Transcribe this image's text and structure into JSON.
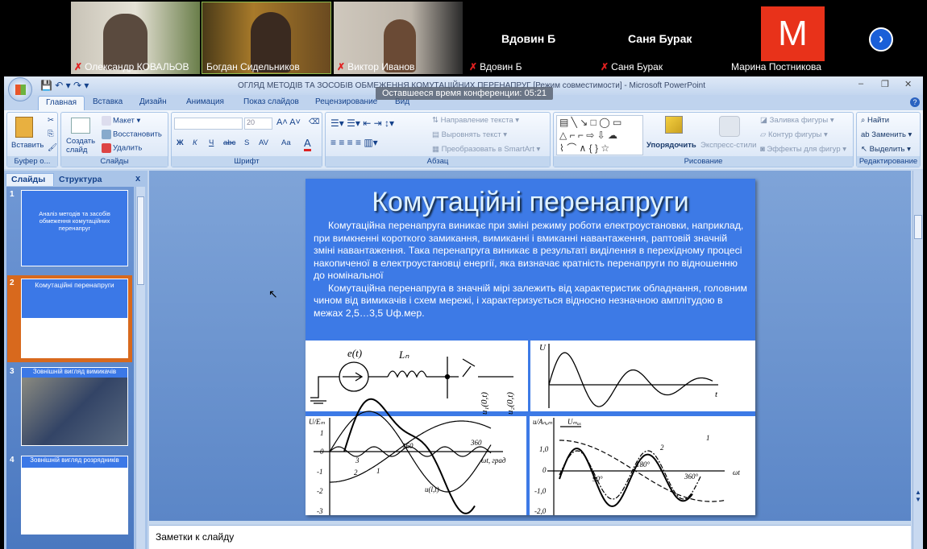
{
  "meeting": {
    "participants": [
      {
        "name": "Олександр КОВАЛЬОВ",
        "muted": true,
        "video": true
      },
      {
        "name": "Богдан Сидельников",
        "muted": false,
        "video": true
      },
      {
        "name": "Виктор Иванов",
        "muted": true,
        "video": true
      },
      {
        "name": "Вдовин Б",
        "muted": true,
        "video": false
      },
      {
        "name": "Саня Бурак",
        "muted": true,
        "video": false
      },
      {
        "name": "Марина Постникова",
        "muted": false,
        "video": false,
        "avatar_letter": "M",
        "avatar_color": "#e8321a"
      }
    ],
    "next_icon": "chevron-right-icon",
    "timer": "Оставшееся время конференции: 05:21"
  },
  "window": {
    "title": "ОГЛЯД МЕТОДІВ ТА ЗОСОБІВ ОБМЕЖЕННЯ КОМУТАЦІЙНИХ ПЕРЕНАПРУГ [Режим совместимости] - Microsoft PowerPoint",
    "tabs": [
      "Главная",
      "Вставка",
      "Дизайн",
      "Анимация",
      "Показ слайдов",
      "Рецензирование",
      "Вид"
    ]
  },
  "ribbon": {
    "clipboard": {
      "paste": "Вставить",
      "label": "Буфер о..."
    },
    "slides": {
      "new_slide": "Создать слайд",
      "layout": "Макет",
      "reset": "Восстановить",
      "delete": "Удалить",
      "label": "Слайды"
    },
    "font": {
      "size": "20",
      "label": "Шрифт",
      "bold": "Ж",
      "italic": "К",
      "underline": "Ч",
      "strike": "abc",
      "shadow": "S",
      "spacing": "AV",
      "case": "Aa",
      "color": "A"
    },
    "paragraph": {
      "direction": "Направление текста",
      "align": "Выровнять текст",
      "smartart": "Преобразовать в SmartArt",
      "label": "Абзац"
    },
    "drawing": {
      "arrange": "Упорядочить",
      "quick_styles": "Экспресс-стили",
      "fill": "Заливка фигуры",
      "outline": "Контур фигуры",
      "effects": "Эффекты для фигур",
      "label": "Рисование"
    },
    "editing": {
      "find": "Найти",
      "replace": "Заменить",
      "select": "Выделить",
      "label": "Редактирование"
    }
  },
  "slides_pane": {
    "tabs": [
      "Слайды",
      "Структура"
    ],
    "close": "x",
    "thumbs": [
      {
        "num": "1",
        "title": "Аналіз методів та засобів обмеження комутаційних перенапруг"
      },
      {
        "num": "2",
        "title": "Комутаційні перенапруги"
      },
      {
        "num": "3",
        "title": "Зовнішній вигляд вимикачів"
      },
      {
        "num": "4",
        "title": "Зовнішній вигляд розрядників"
      }
    ]
  },
  "slide": {
    "title": "Комутаційні перенапруги",
    "para1": "Комутаційна перенапруга виникає при зміні режиму роботи електроустановки, наприклад, при вимкненні короткого замикання, вимиканні і вмиканні навантаження, раптовій значній зміні навантаження. Така перенапруга виникає в результаті виділення в перехідному процесі накопиченої в електроустановці енергії, яка визначає кратність перенапруги по відношенню до номінальної",
    "para2": "Комутаційна перенапруга в значній мірі залежить від характеристик обладнання, головним чином від вимикачів і схем мережі, і характеризується відносно незначною амплітудою в межах 2,5…3,5 Uф.мер.",
    "fig1": {
      "e": "e(t)",
      "L": "Lₙ",
      "u1": "u₁(0,t)",
      "u2": "u₂(0,t)"
    },
    "fig2": {
      "y": "U",
      "x": "t"
    },
    "fig3": {
      "y": "U/Eₘ",
      "ticks": [
        "1",
        "0",
        "-1",
        "-2",
        "-3"
      ],
      "x": "ωt, град",
      "t160": "160",
      "t360": "360",
      "c1": "1",
      "c2": "2",
      "c3": "3",
      "cu": "u(l,t)"
    },
    "fig4": {
      "y": "u/Aₙₒₘ",
      "umax": "Uₘₐₓ",
      "ticks": [
        "1,0",
        "0",
        "-1,0",
        "-2,0"
      ],
      "a90": "90°",
      "a180": "180°",
      "a360": "360°",
      "x": "ωt",
      "c1": "1",
      "c2": "2"
    }
  },
  "notes": {
    "placeholder": "Заметки к слайду"
  }
}
